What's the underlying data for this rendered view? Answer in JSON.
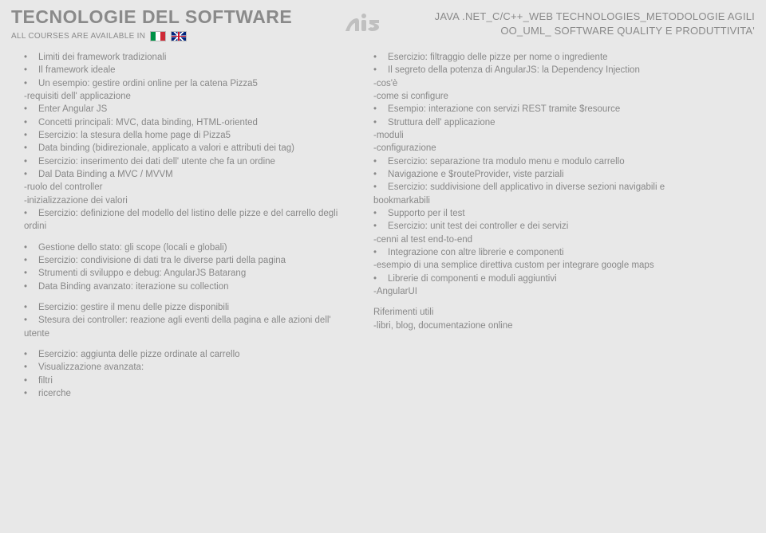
{
  "header": {
    "title": "TECNOLOGIE DEL SOFTWARE",
    "subtitle": "ALL COURSES ARE AVAILABLE IN",
    "right_line1": "JAVA .NET_C/C++_WEB TECHNOLOGIES_METODOLOGIE AGILI",
    "right_line2": "OO_UML_ SOFTWARE QUALITY E PRODUTTIVITA'"
  },
  "col1": {
    "b1": [
      {
        "t": "bullet",
        "v": "Limiti dei framework tradizionali"
      },
      {
        "t": "bullet",
        "v": "Il framework ideale"
      },
      {
        "t": "bullet",
        "v": "Un esempio: gestire ordini online per la catena Pizza5",
        "wrap": true
      },
      {
        "t": "plain",
        "v": "-requisiti dell' applicazione"
      },
      {
        "t": "bullet",
        "v": "Enter Angular JS"
      },
      {
        "t": "bullet",
        "v": "Concetti principali: MVC, data binding, HTML-oriented",
        "wrap": true
      },
      {
        "t": "bullet",
        "v": "Esercizio: la stesura della home page di Pizza5"
      },
      {
        "t": "bullet",
        "v": "Data binding (bidirezionale, applicato a valori e attributi dei tag)",
        "wrap": true
      },
      {
        "t": "bullet",
        "v": "Esercizio: inserimento dei dati dell' utente che fa un ordine",
        "wrap": true
      },
      {
        "t": "bullet",
        "v": "Dal Data Binding a MVC / MVVM"
      },
      {
        "t": "plain",
        "v": "-ruolo del controller"
      },
      {
        "t": "plain",
        "v": "-inizializzazione dei valori"
      },
      {
        "t": "bullet",
        "v": "Esercizio: definizione del modello del listino delle pizze e del carrello degli ordini",
        "wrap": true
      }
    ],
    "b2": [
      {
        "t": "bullet",
        "v": "Gestione dello stato: gli scope (locali e globali)"
      },
      {
        "t": "bullet",
        "v": "Esercizio: condivisione di dati tra le diverse parti della pagina",
        "wrap": true
      },
      {
        "t": "bullet",
        "v": "Strumenti di sviluppo e debug: AngularJS Batarang",
        "wrap": true
      },
      {
        "t": "bullet",
        "v": "Data Binding avanzato: iterazione su collection"
      }
    ],
    "b3": [
      {
        "t": "bullet",
        "v": "Esercizio: gestire il menu delle pizze disponibili"
      },
      {
        "t": "bullet",
        "v": "Stesura dei controller: reazione agli eventi della pagina e alle azioni dell' utente",
        "wrap": true
      }
    ],
    "b4": [
      {
        "t": "bullet",
        "v": "Esercizio: aggiunta delle pizze ordinate al carrello"
      },
      {
        "t": "bullet",
        "v": "Visualizzazione avanzata:"
      },
      {
        "t": "bullet",
        "v": "filtri"
      },
      {
        "t": "bullet",
        "v": "ricerche"
      }
    ]
  },
  "col2": {
    "b1": [
      {
        "t": "bullet",
        "v": "Esercizio: filtraggio delle pizze per nome o ingrediente",
        "wrap": true
      },
      {
        "t": "bullet",
        "v": "Il segreto della potenza di AngularJS: la Dependency Injection",
        "wrap": true
      },
      {
        "t": "plain",
        "v": "-cos'è"
      },
      {
        "t": "plain",
        "v": "-come si configure"
      },
      {
        "t": "bullet",
        "v": "Esempio: interazione con servizi REST tramite $resource",
        "wrap": true,
        "just": true
      },
      {
        "t": "bullet",
        "v": "Struttura dell' applicazione"
      },
      {
        "t": "plain",
        "v": "-moduli"
      },
      {
        "t": "plain",
        "v": "-configurazione"
      },
      {
        "t": "bullet",
        "v": "Esercizio: separazione tra modulo menu e modulo carrello",
        "wrap": true
      },
      {
        "t": "bullet",
        "v": "Navigazione e $routeProvider, viste parziali"
      },
      {
        "t": "bullet",
        "v": "Esercizio: suddivisione dell applicativo in diverse sezioni navigabili e bookmarkabili",
        "wrap": true
      },
      {
        "t": "bullet",
        "v": "Supporto per il test"
      },
      {
        "t": "bullet",
        "v": "Esercizio: unit test dei controller e dei servizi"
      },
      {
        "t": "plain",
        "v": "-cenni al test end-to-end"
      },
      {
        "t": "bullet",
        "v": "Integrazione con altre librerie e componenti"
      },
      {
        "t": "plain",
        "v": "-esempio di una semplice direttiva custom per integrare google maps",
        "just": true
      },
      {
        "t": "bullet",
        "v": "Librerie di componenti e moduli aggiuntivi"
      },
      {
        "t": "plain",
        "v": "-AngularUI"
      }
    ],
    "b2": [
      {
        "t": "plain",
        "v": "Riferimenti utili"
      },
      {
        "t": "plain",
        "v": "-libri, blog, documentazione online"
      }
    ]
  }
}
